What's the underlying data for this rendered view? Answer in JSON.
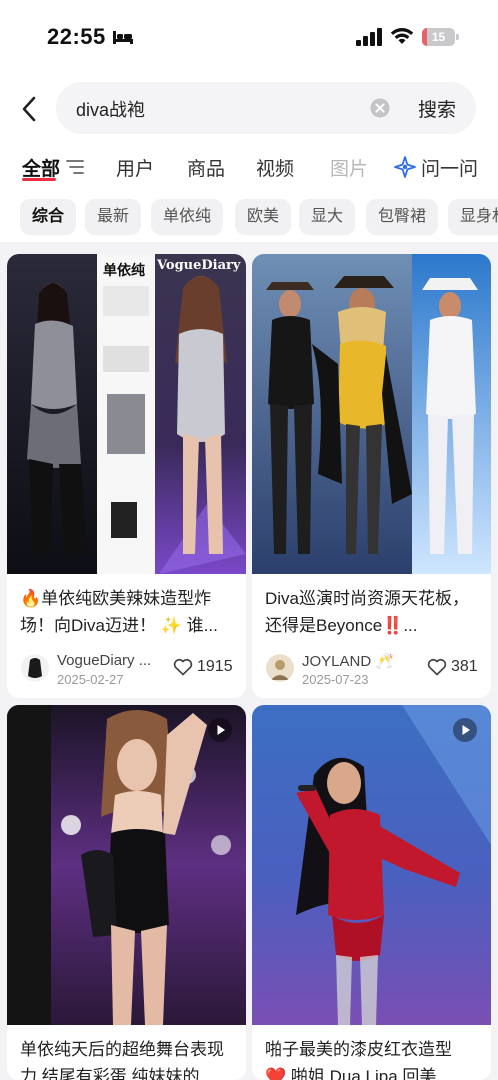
{
  "status_bar": {
    "time": "22:55",
    "battery_level": "15",
    "battery_fraction": 0.15
  },
  "header": {
    "search_query": "diva战袍",
    "search_button": "搜索"
  },
  "tabs": [
    {
      "label": "全部"
    },
    {
      "label": "用户"
    },
    {
      "label": "商品"
    },
    {
      "label": "视频"
    },
    {
      "label": "图片"
    },
    {
      "label": "问一问"
    }
  ],
  "chips": [
    "综合",
    "最新",
    "单依纯",
    "欧美",
    "显大",
    "包臀裙",
    "显身材"
  ],
  "cards": [
    {
      "title": "🔥单依纯欧美辣妹造型炸场！向Diva迈进！ ✨ 谁...",
      "author": "VogueDiary ...",
      "date": "2025-02-27",
      "likes": "1915",
      "ribbon": "单依纯",
      "brand": "VogueDiary"
    },
    {
      "title": "Diva巡演时尚资源天花板，还得是Beyonce‼️...",
      "author": "JOYLAND 🥂",
      "date": "2025-07-23",
      "likes": "381"
    },
    {
      "title": "单依纯天后的超绝舞台表现力 结尾有彩蛋 纯妹妹的..."
    },
    {
      "title": "啪子最美的漆皮红衣造型 ❤️ 啪姐 Dua Lipa 回美..."
    }
  ],
  "colors": {
    "accent": "#ef2d3f",
    "background": "#f3f3f5",
    "card": "#ffffff"
  },
  "icons": {
    "back": "chevron-left-icon",
    "clear": "close-circle-icon",
    "filter": "filter-lines-icon",
    "ask": "sparkle-icon",
    "like": "heart-outline-icon",
    "play": "play-icon"
  }
}
